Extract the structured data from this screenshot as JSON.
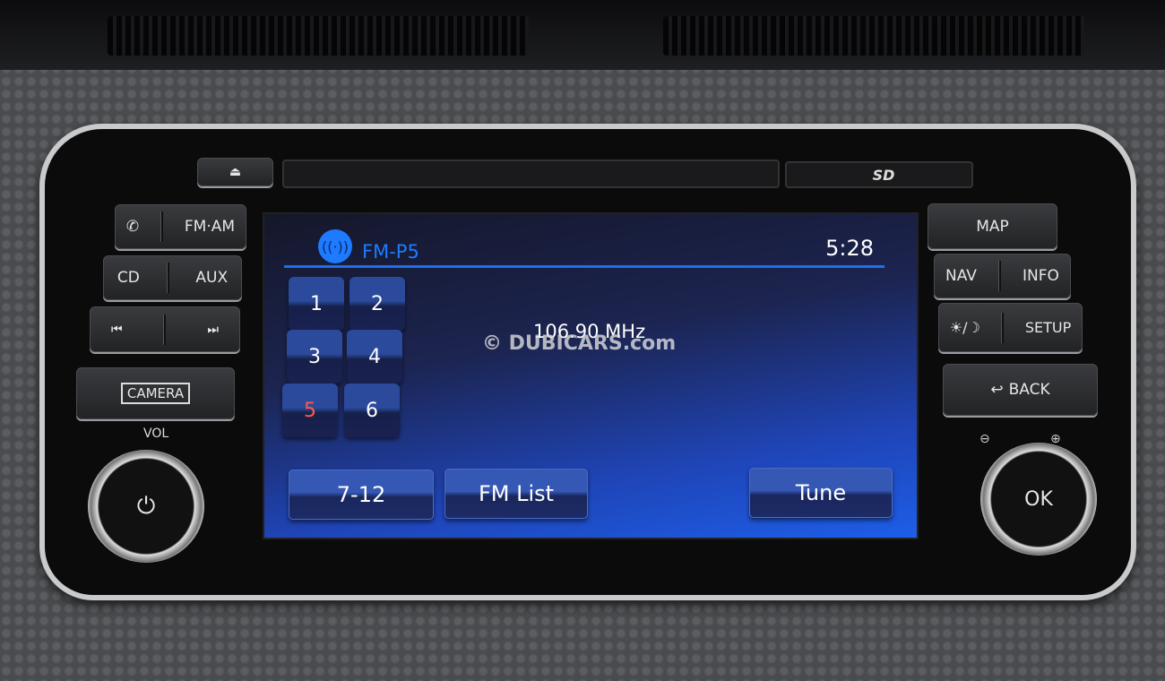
{
  "hardware": {
    "eject_icon": "eject-icon",
    "sd_label": "SD",
    "left": {
      "phone_icon": "phone-icon",
      "fm_am": "FM·AM",
      "cd": "CD",
      "aux": "AUX",
      "prev_icon": "⏮",
      "next_icon": "⏭",
      "camera": "CAMERA",
      "vol": "VOL",
      "power_icon": "⏻"
    },
    "right": {
      "map": "MAP",
      "nav": "NAV",
      "info": "INFO",
      "daynight": "☀/☽",
      "setup": "SETUP",
      "back": "BACK",
      "back_icon": "↩",
      "zoom_out": "⊖",
      "zoom_in": "⊕",
      "ok": "OK"
    }
  },
  "screen": {
    "source": "FM-P5",
    "time": "5:28",
    "frequency": "106.90 MHz",
    "radio_icon": "radio-waves-icon",
    "presets": [
      "1",
      "2",
      "3",
      "4",
      "5",
      "6"
    ],
    "active_preset": "5",
    "buttons": {
      "more": "7-12",
      "list": "FM List",
      "tune": "Tune"
    },
    "accent": "#1e7bff",
    "active_color": "#ff5a4a"
  },
  "watermark": "© DUBICARS.com"
}
